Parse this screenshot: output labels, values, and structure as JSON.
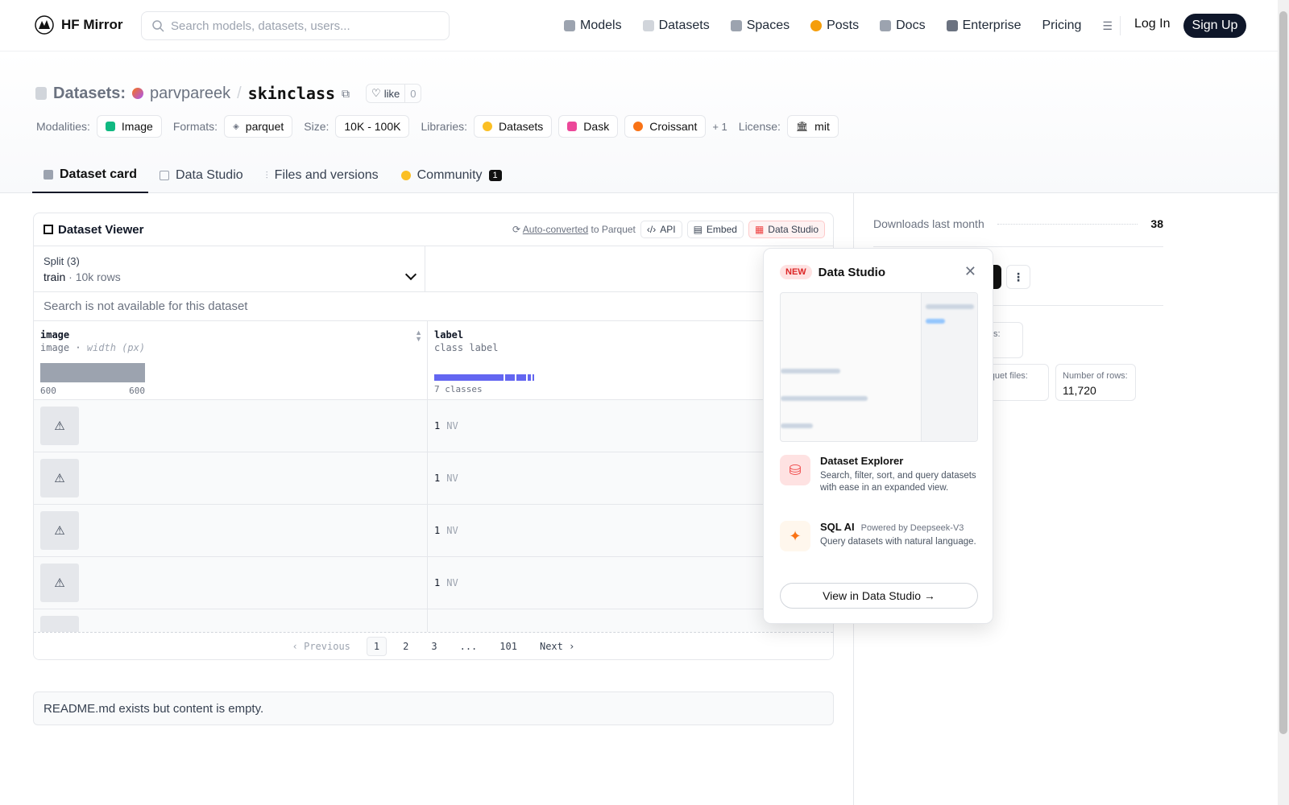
{
  "nav": {
    "brand": "HF Mirror",
    "search_placeholder": "Search models, datasets, users...",
    "links": [
      {
        "label": "Models",
        "icon": "cube-icon",
        "color": "#9ca3af"
      },
      {
        "label": "Datasets",
        "icon": "database-icon",
        "color": "#d1d5db"
      },
      {
        "label": "Spaces",
        "icon": "grid-icon",
        "color": "#9ca3af"
      },
      {
        "label": "Posts",
        "icon": "chat-icon",
        "color": "#f59e0b"
      },
      {
        "label": "Docs",
        "icon": "book-icon",
        "color": "#9ca3af"
      },
      {
        "label": "Enterprise",
        "icon": "enterprise-icon",
        "color": "#6b7280"
      },
      {
        "label": "Pricing",
        "icon": "",
        "color": ""
      }
    ],
    "login": "Log In",
    "signup": "Sign Up"
  },
  "repo": {
    "type_label": "Datasets:",
    "owner": "parvpareek",
    "separator": "/",
    "name": "skinclass",
    "like_label": "like",
    "like_count": "0"
  },
  "meta": {
    "modalities_label": "Modalities:",
    "modality": "Image",
    "formats_label": "Formats:",
    "format": "parquet",
    "size_label": "Size:",
    "size": "10K - 100K",
    "libraries_label": "Libraries:",
    "libraries": [
      "Datasets",
      "Dask",
      "Croissant"
    ],
    "libraries_more": "+ 1",
    "license_label": "License:",
    "license": "mit"
  },
  "tabs": [
    {
      "label": "Dataset card",
      "active": true
    },
    {
      "label": "Data Studio",
      "active": false
    },
    {
      "label": "Files and versions",
      "active": false
    },
    {
      "label": "Community",
      "active": false,
      "badge": "1"
    }
  ],
  "viewer": {
    "title": "Dataset Viewer",
    "auto_converted": "Auto-converted",
    "to_parquet": "to Parquet",
    "api": "API",
    "embed": "Embed",
    "data_studio": "Data Studio",
    "split_title": "Split (3)",
    "split_name": "train",
    "split_sep": "·",
    "split_rows": "10k rows",
    "search_na": "Search is not available for this dataset",
    "col1_name": "image",
    "col1_type": "image",
    "col1_type_sep": " · ",
    "col1_type_extra": "width (px)",
    "col1_min": "600",
    "col1_max": "600",
    "col2_name": "label",
    "col2_type": "class label",
    "col2_classes": "7 classes",
    "rows": [
      {
        "label": "1",
        "class": "NV"
      },
      {
        "label": "1",
        "class": "NV"
      },
      {
        "label": "1",
        "class": "NV"
      },
      {
        "label": "1",
        "class": "NV"
      }
    ],
    "pager": {
      "previous": "Previous",
      "pages": [
        "1",
        "2",
        "3",
        "...",
        "101"
      ],
      "next": "Next"
    }
  },
  "readme_text": "README.md exists but content is empty.",
  "right": {
    "downloads_label": "Downloads last month",
    "downloads": "38",
    "files_label": "files:",
    "parquet_files_label": "arquet files:",
    "rows_label": "Number of rows:",
    "rows_value": "11,720"
  },
  "popover": {
    "new": "NEW",
    "title": "Data Studio",
    "close": "✕",
    "explorer_title": "Dataset Explorer",
    "explorer_desc": "Search, filter, sort, and query datasets with ease in an expanded view.",
    "sql_title": "SQL AI",
    "sql_powered": "Powered by Deepseek-V3",
    "sql_desc": "Query datasets with natural language.",
    "button": "View in Data Studio →"
  }
}
